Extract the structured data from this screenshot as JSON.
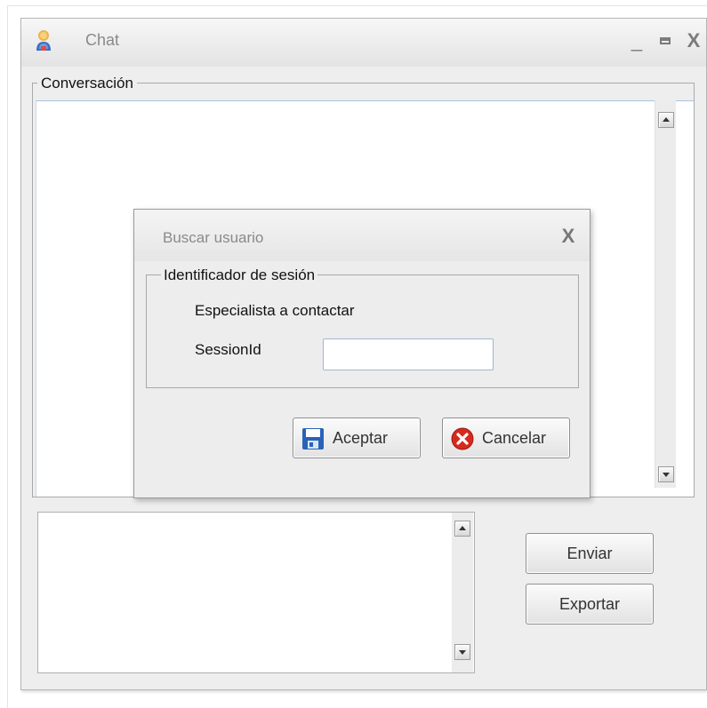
{
  "window": {
    "title": "Chat",
    "minimize": "_",
    "close": "X"
  },
  "conversation": {
    "legend": "Conversación"
  },
  "buttons": {
    "send": "Enviar",
    "export": "Exportar"
  },
  "dialog": {
    "title": "Buscar usuario",
    "close": "X",
    "group_legend": "Identificador de sesión",
    "specialist_label": "Especialista a contactar",
    "sessionid_label": "SessionId",
    "sessionid_value": "",
    "accept": "Aceptar",
    "cancel": "Cancelar"
  },
  "icons": {
    "app": "chat-person-icon",
    "accept": "floppy-disk-icon",
    "cancel": "red-x-circle-icon"
  },
  "colors": {
    "accent_blue": "#2a62b8",
    "cancel_red": "#d62a1e"
  }
}
